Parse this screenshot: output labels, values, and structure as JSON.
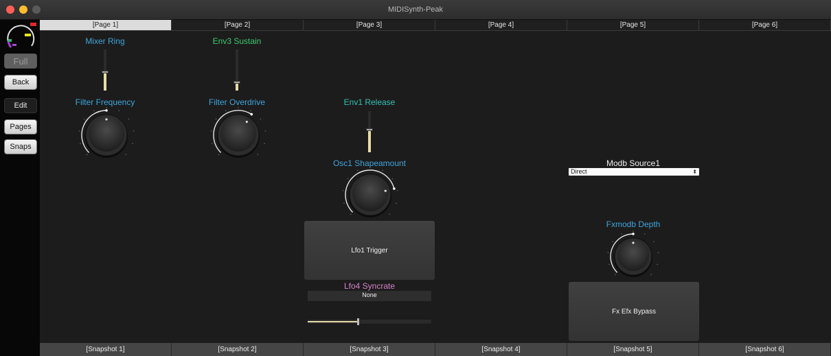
{
  "window": {
    "title": "MIDISynth-Peak"
  },
  "sidebar": {
    "meter_icon": "level-meter-icon",
    "full_label": "Full",
    "back_label": "Back",
    "edit_label": "Edit",
    "pages_label": "Pages",
    "snaps_label": "Snaps"
  },
  "pages": [
    "[Page 1]",
    "[Page 2]",
    "[Page 3]",
    "[Page 4]",
    "[Page 5]",
    "[Page 6]"
  ],
  "active_page": 0,
  "snapshots": [
    "[Snapshot 1]",
    "[Snapshot 2]",
    "[Snapshot 3]",
    "[Snapshot 4]",
    "[Snapshot 5]",
    "[Snapshot 6]"
  ],
  "controls": {
    "mixer_ring": {
      "label": "Mixer Ring",
      "value": 0.45
    },
    "env3_sustain": {
      "label": "Env3 Sustain",
      "value": 0.2
    },
    "filter_frequency": {
      "label": "Filter Frequency",
      "value": 0.5
    },
    "filter_overdrive": {
      "label": "Filter Overdrive",
      "value": 0.62
    },
    "env1_release": {
      "label": "Env1 Release",
      "value": 0.55
    },
    "osc1_shapeamount": {
      "label": "Osc1 Shapeamount",
      "value": 0.78
    },
    "lfo1_trigger": {
      "label": "Lfo1 Trigger"
    },
    "lfo4_syncrate": {
      "label": "Lfo4 Syncrate",
      "value": "None",
      "slider": 0.4
    },
    "modb_source1": {
      "label": "Modb Source1",
      "value": "Direct"
    },
    "fxmodb_depth": {
      "label": "Fxmodb Depth",
      "value": 0.5
    },
    "fx_efx_bypass": {
      "label": "Fx Efx Bypass"
    }
  },
  "colors": {
    "blue_label": "#3ea5dc",
    "green_label": "#3fc96f",
    "teal_label": "#35c1b5",
    "pink_label": "#d682c8",
    "fill_accent": "#e8dca8"
  }
}
